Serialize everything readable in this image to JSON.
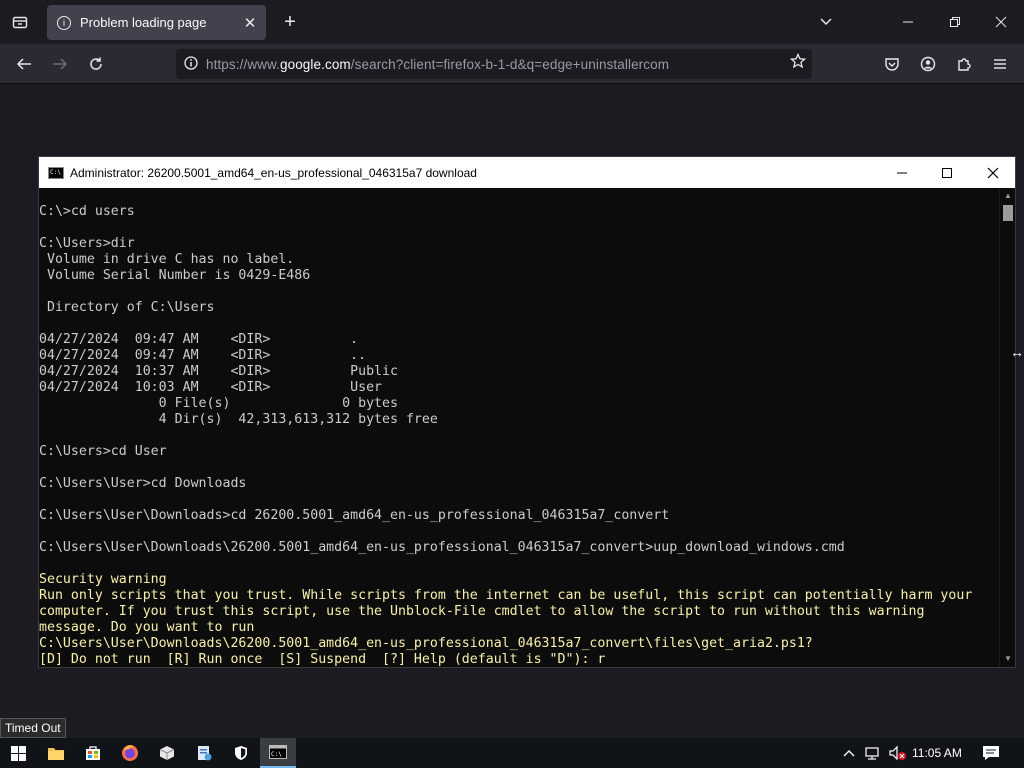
{
  "browser": {
    "tab": {
      "title": "Problem loading page"
    },
    "new_tab_symbol": "+",
    "url": {
      "prefix": "https://www.",
      "host": "google.com",
      "path": "/search?client=firefox-b-1-d&q=edge+uninstallercom"
    },
    "icons": {
      "tab_manager": "tab-list-icon",
      "back": "arrow-left-icon",
      "forward": "arrow-right-icon",
      "reload": "reload-icon",
      "site_info": "info-icon",
      "bookmark": "star-icon",
      "pocket": "pocket-icon",
      "account": "account-icon",
      "extensions": "puzzle-icon",
      "menu": "hamburger-icon"
    }
  },
  "console": {
    "title": "Administrator:  26200.5001_amd64_en-us_professional_046315a7 download",
    "lines": [
      "C:\\>cd users",
      "",
      "C:\\Users>dir",
      " Volume in drive C has no label.",
      " Volume Serial Number is 0429-E486",
      "",
      " Directory of C:\\Users",
      "",
      "04/27/2024  09:47 AM    <DIR>          .",
      "04/27/2024  09:47 AM    <DIR>          ..",
      "04/27/2024  10:37 AM    <DIR>          Public",
      "04/27/2024  10:03 AM    <DIR>          User",
      "               0 File(s)              0 bytes",
      "               4 Dir(s)  42,313,613,312 bytes free",
      "",
      "C:\\Users>cd User",
      "",
      "C:\\Users\\User>cd Downloads",
      "",
      "C:\\Users\\User\\Downloads>cd 26200.5001_amd64_en-us_professional_046315a7_convert",
      "",
      "C:\\Users\\User\\Downloads\\26200.5001_amd64_en-us_professional_046315a7_convert>uup_download_windows.cmd",
      "",
      "Security warning",
      "Run only scripts that you trust. While scripts from the internet can be useful, this script can potentially harm your",
      "computer. If you trust this script, use the Unblock-File cmdlet to allow the script to run without this warning",
      "message. Do you want to run",
      "C:\\Users\\User\\Downloads\\26200.5001_amd64_en-us_professional_046315a7_convert\\files\\get_aria2.ps1?",
      "[D] Do not run  [R] Run once  [S] Suspend  [?] Help (default is \"D\"): r"
    ]
  },
  "tooltip": {
    "text": "Timed Out"
  },
  "taskbar": {
    "clock": "11:05 AM",
    "apps": [
      "start-icon",
      "file-explorer-icon",
      "store-icon",
      "firefox-icon",
      "package-icon",
      "app-icon",
      "security-icon",
      "cmd-icon"
    ]
  },
  "colors": {
    "console_bg": "#0c0c0c",
    "console_text": "#cccccc",
    "warning_text": "#f9f1a5",
    "browser_bg": "#1c1b22",
    "taskbar_bg": "#101418"
  }
}
